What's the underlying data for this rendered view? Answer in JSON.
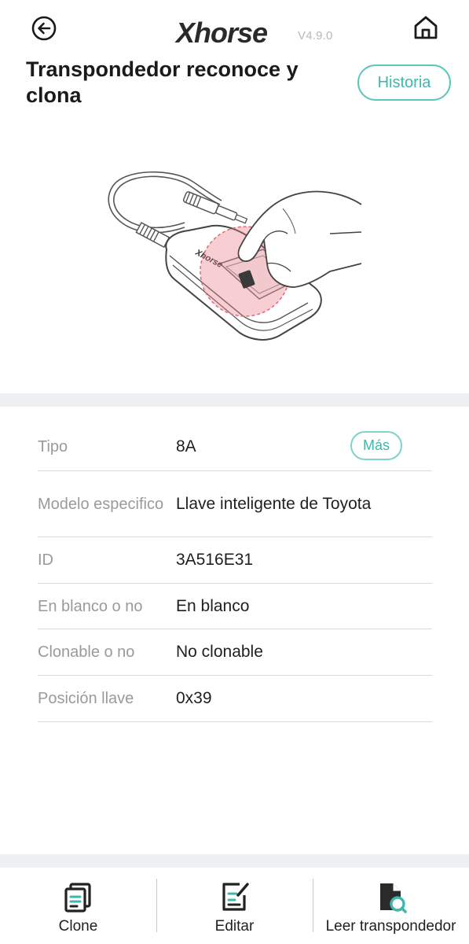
{
  "header": {
    "brand": "Xhorse",
    "version": "V4.9.0",
    "title": "Transpondedor reconoce y clona",
    "history_label": "Historia"
  },
  "info": {
    "more_label": "Más",
    "rows": [
      {
        "label": "Tipo",
        "value": "8A"
      },
      {
        "label": "Modelo especifico",
        "value": "Llave inteligente de Toyota"
      },
      {
        "label": "ID",
        "value": "3A516E31"
      },
      {
        "label": "En blanco o no",
        "value": "En blanco"
      },
      {
        "label": "Clonable o no",
        "value": "No clonable"
      },
      {
        "label": "Posición llave",
        "value": "0x39"
      }
    ]
  },
  "bottom_nav": [
    {
      "label": "Clone",
      "icon": "clone-icon"
    },
    {
      "label": "Editar",
      "icon": "edit-icon"
    },
    {
      "label": "Leer transpondedor",
      "icon": "read-transponder-icon"
    }
  ],
  "colors": {
    "accent": "#3fb7ac",
    "accent_border": "#5cc7bd",
    "label_gray": "#9a9a9a",
    "band": "#eef0f2",
    "highlight_red": "#e8737a"
  }
}
